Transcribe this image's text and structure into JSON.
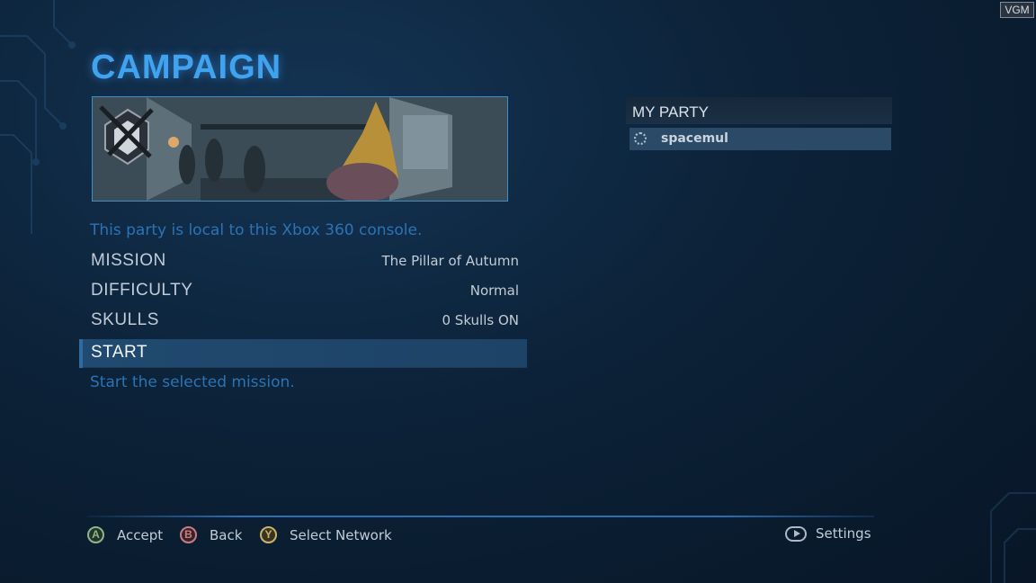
{
  "watermark": "VGM",
  "screen": {
    "title": "CAMPAIGN",
    "info_text": "This party is local to this Xbox 360 console.",
    "help_text": "Start the selected mission."
  },
  "menu": {
    "items": [
      {
        "label": "MISSION",
        "value": "The Pillar of Autumn"
      },
      {
        "label": "DIFFICULTY",
        "value": "Normal"
      },
      {
        "label": "SKULLS",
        "value": "0 Skulls ON"
      },
      {
        "label": "START",
        "value": "",
        "selected": true
      }
    ]
  },
  "party": {
    "header": "MY PARTY",
    "members": [
      {
        "name": "spacemul",
        "status_icon": "loading-spinner-icon"
      }
    ]
  },
  "footer": {
    "accept": {
      "button": "A",
      "label": "Accept"
    },
    "back": {
      "button": "B",
      "label": "Back"
    },
    "network": {
      "button": "Y",
      "label": "Select Network"
    },
    "settings": {
      "button": "start-button-icon",
      "label": "Settings"
    }
  },
  "colors": {
    "title": "#3fa3f0",
    "info_text": "#2a74b5",
    "selected_row": "#214a70",
    "button_a": "#8fb58c",
    "button_b": "#c97c84",
    "button_y": "#c9b46d"
  }
}
